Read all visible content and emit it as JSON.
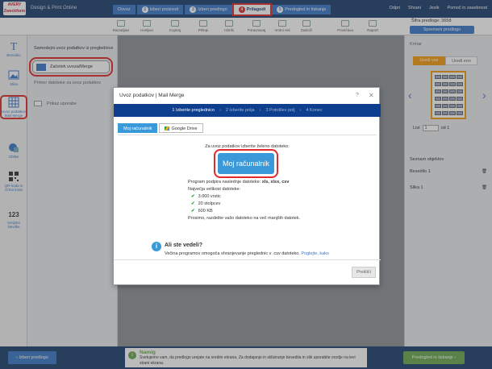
{
  "app": {
    "logo_line1": "AVERY",
    "logo_line2": "Zweckform",
    "title": "Design & Print Online"
  },
  "steps": [
    {
      "num": "",
      "label": "Dovoz"
    },
    {
      "num": "2",
      "label": "Izberi proizvod"
    },
    {
      "num": "3",
      "label": "Izberi predlogo"
    },
    {
      "num": "4",
      "label": "Prilagodi"
    },
    {
      "num": "5",
      "label": "Predogled in tiskanje"
    }
  ],
  "topright": {
    "open": "Odpri",
    "save": "Shrani",
    "lang": "Jezik",
    "help": "Pomoč in zasebnost"
  },
  "toolbar": {
    "items": [
      "Razveljavi",
      "Uveljavi",
      "Kopiraj",
      "Prilepi",
      "Izbriši",
      "Poravnavaj",
      "Vrstni red",
      "Zasloži",
      "Povečava",
      "Raport"
    ],
    "dimension": "Šifra predloge: 3658",
    "change_button": "Spremeni predlogo"
  },
  "leftrail": [
    {
      "label": "Besedilo",
      "icon": "text-icon"
    },
    {
      "label": "Slika",
      "icon": "image-icon"
    },
    {
      "label": "Uvoz podatkov Mail Merge",
      "icon": "table-icon"
    },
    {
      "label": "Oblike",
      "icon": "shapes-icon"
    },
    {
      "label": "QR-koda in Črtna koda",
      "icon": "qr-icon"
    },
    {
      "label": "Serijske številke",
      "icon": "numbers-icon"
    }
  ],
  "panel": {
    "intro": "Samodejni uvoz podatkov iz preglednice",
    "start_button": "Začetek uvoza/Merge",
    "example": "Primer datoteke za uvoz podatkov",
    "video": "Prikaz uporabe"
  },
  "rightpanel": {
    "header": "Krmar",
    "tab_all": "Uredi vse",
    "tab_one": "Uredi eno",
    "sheet_label": "List",
    "sheet_value": "1",
    "sheet_of": "od 1",
    "objects_header": "Seznam objektov",
    "objects": [
      "Besedilo 1",
      "Slika 1"
    ]
  },
  "footer": {
    "back": "Izberi predlogo",
    "next": "Predogled in tiskanje",
    "tip_title": "Namig",
    "tip_body": "Svetujemo vam, da predlogo urejate na sredini ekrana. Za dodajanje in stiliziranje besedila in slik uporabite orodje na levi strani ekrana."
  },
  "modal": {
    "title": "Uvoz podatkov | Mail Merge",
    "help": "?",
    "close": "✕",
    "steps": [
      "1 Izberite preglednico",
      "2 Izberite polja",
      "3 Potrdilev polj",
      "4 Konec"
    ],
    "tab_computer": "Moj računalnik",
    "tab_drive": "Google Drive",
    "prompt": "Za uvoz podatkov izberite želeno datoteko:",
    "big_button": "Moj računalnik",
    "formats_label": "Program podpira naslednje datoteke:",
    "formats": "xls, xlsx, csv",
    "max_label": "Največja velikost datoteke:",
    "limits": [
      "3.000 vrstic",
      "20 stolpcev",
      "600 KB"
    ],
    "split_note": "Prosimo, razdelite vašo datoteko na več manjših datotek.",
    "tip_title": "Ali ste vedeli?",
    "tip_body": "Večina programov omogoča shranjevanje preglednic v .csv datoteko.",
    "tip_link": "Poglejte, kako",
    "cancel": "Prekliči"
  }
}
